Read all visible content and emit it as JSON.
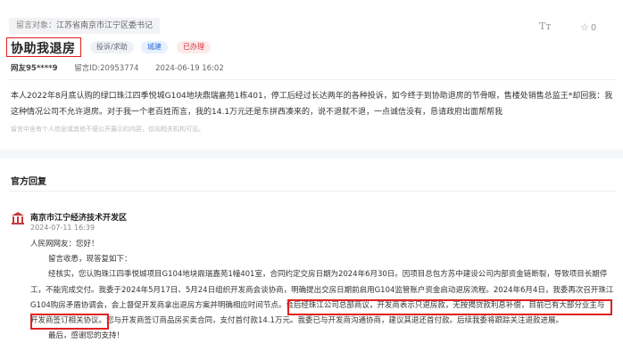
{
  "message": {
    "target_prefix": "留言对象：",
    "target": "江苏省南京市江宁区委书记",
    "title": "协助我退房",
    "tags": {
      "type": "投诉/求助",
      "field": "城建",
      "status": "已办理"
    },
    "author": "网友95****9",
    "id": "留言ID:20953774",
    "date": "2024-06-19 16:02",
    "body": "本人2022年8月底认购的绿口珠江四季悦城G104地块鼎瑞嘉苑1栋401，停工后经过长达两年的各种投诉，如今终于到协助退房的节骨眼，售楼处销售总监王*却回我：我这种情况公司不允许退房。对于我一个老百姓而言，我的14.1万元还是东拼西凑来的，说不退就不退，一点诚信没有，恳请政府出面帮帮我",
    "disclaimer": "留言中含有个人信息或其他不便公开展示的内容，仅向相关机构可见。"
  },
  "toolbar": {
    "font_icon": "Tт",
    "fav_count": "0"
  },
  "reply": {
    "section_title": "官方回复",
    "org": "南京市江宁经济技术开发区",
    "date": "2024-07-11 16:39",
    "greeting": "人民网网友：您好！",
    "l1": "留言收悉，现答复如下：",
    "l2": "经核实，您认购珠江四季悦城项目G104地块鼎瑞嘉苑1幢401室，合同约定交房日期为2024年6月30日。因项目总包方苏中建设公司内部资金链断裂，导致项目长期停",
    "l3": "工，不能完成交付。我委于2024年5月17日、5月24日组织开发商会谈协商，明确提出交房日期前启用G104监管账户资金启动退房流程。2024年6月4日，我委再次召开珠江",
    "l4a": "G104购房矛盾协调会，会上督促开发商拿出退房方案并明确相应时间节点。",
    "l4b": "会后经珠江公司总部商议，开发商表示只退房款，无按揭贷款利息补偿，目前已有大部分业主与",
    "l5a": "开发商签订相关协议。",
    "l5b": "您与开发商签订商品房买卖合同，支付首付款14.1万元。我委已与开发商沟通协商，建议其退还首付款。后续我委将跟踪关注退款进展。",
    "l6": "最后，感谢您的支持！"
  },
  "colors": {
    "highlight": "#e02020",
    "link_blue": "#2a6bd8",
    "status_red": "#d0343a"
  }
}
